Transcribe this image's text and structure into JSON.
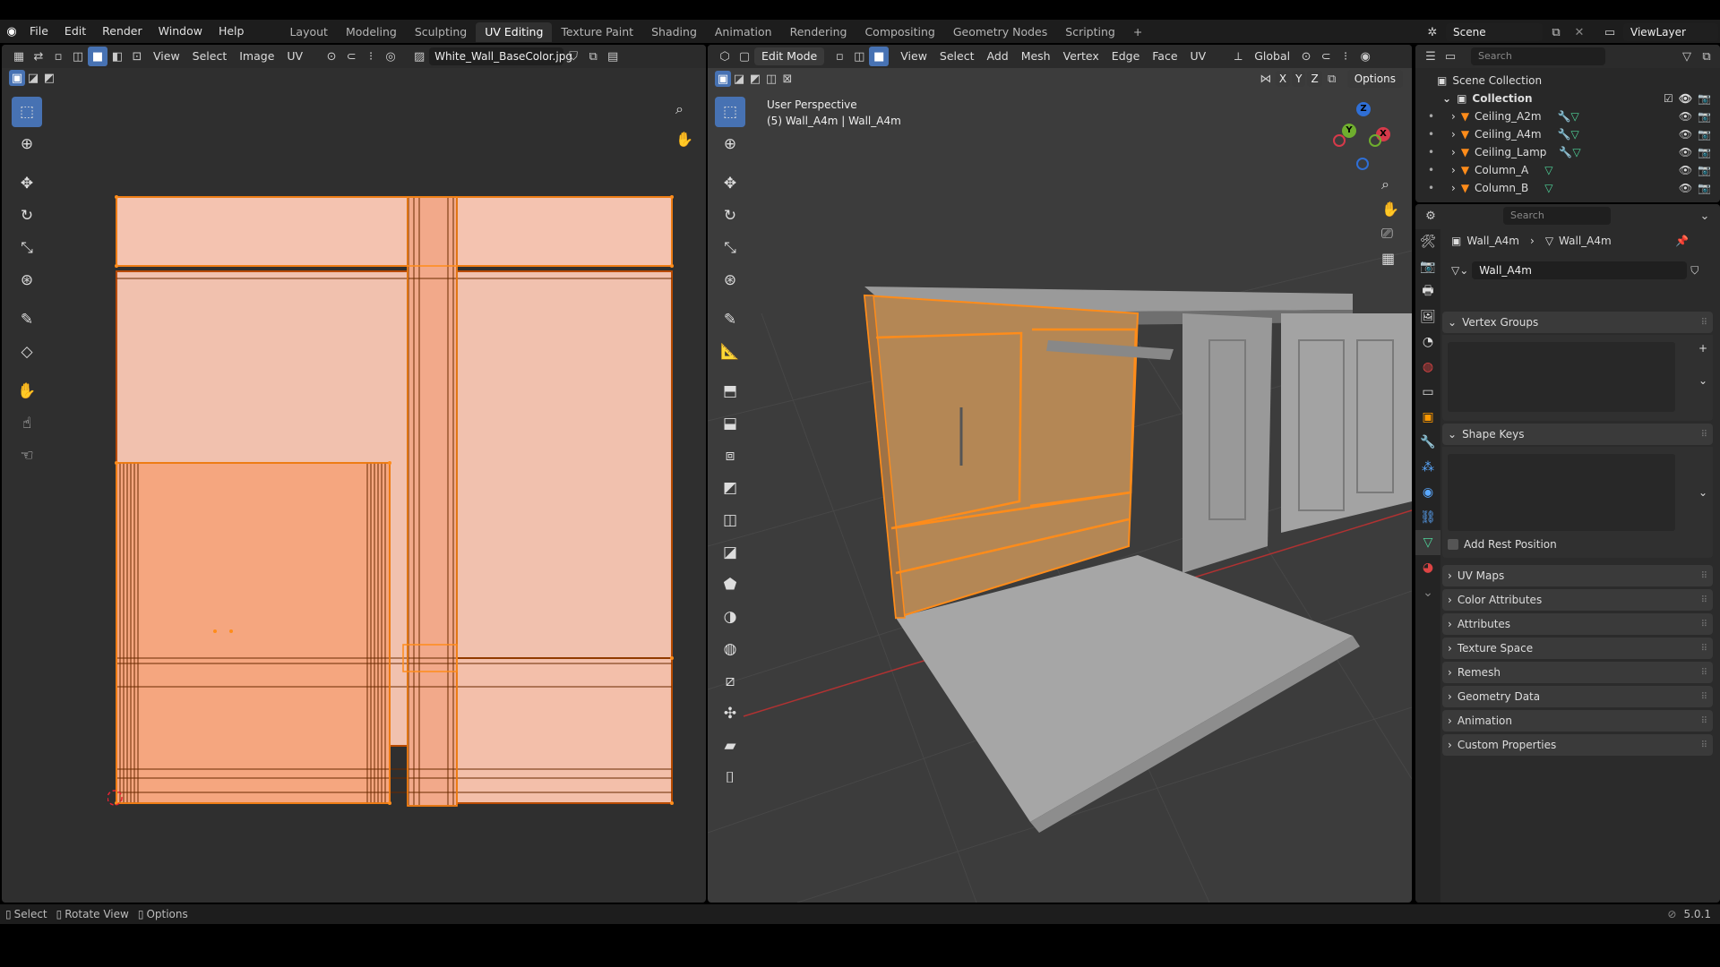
{
  "topbar": {
    "menus": [
      "File",
      "Edit",
      "Render",
      "Window",
      "Help"
    ],
    "workspaces": [
      "Layout",
      "Modeling",
      "Sculpting",
      "UV Editing",
      "Texture Paint",
      "Shading",
      "Animation",
      "Rendering",
      "Compositing",
      "Geometry Nodes",
      "Scripting"
    ],
    "active_workspace": "UV Editing",
    "add_tab": "+",
    "scene_label": "Scene",
    "viewlayer_label": "ViewLayer"
  },
  "uv_editor": {
    "menus": [
      "View",
      "Select",
      "Image",
      "UV"
    ],
    "image_name": "White_Wall_BaseColor.jpg",
    "colors": {
      "uv_fill": "#f4c3b0",
      "uv_selected": "#f5a67f",
      "uv_edge": "#ff8c1a",
      "bg": "#2f2f2f"
    }
  },
  "viewport": {
    "mode": "Edit Mode",
    "menus": [
      "View",
      "Select",
      "Add",
      "Mesh",
      "Vertex",
      "Edge",
      "Face",
      "UV"
    ],
    "transform_orientation": "Global",
    "axes": [
      "X",
      "Y",
      "Z"
    ],
    "options_label": "Options",
    "overlay_title": "User Perspective",
    "overlay_object": "(5) Wall_A4m | Wall_A4m",
    "gizmo": {
      "x": "X",
      "y": "Y",
      "z": "Z"
    }
  },
  "outliner": {
    "search_placeholder": "Search",
    "root": "Scene Collection",
    "collection": "Collection",
    "items": [
      {
        "name": "Ceiling_A2m"
      },
      {
        "name": "Ceiling_A4m"
      },
      {
        "name": "Ceiling_Lamp"
      },
      {
        "name": "Column_A"
      },
      {
        "name": "Column_B"
      }
    ]
  },
  "properties": {
    "search_placeholder": "Search",
    "breadcrumb": [
      "Wall_A4m",
      "Wall_A4m"
    ],
    "mesh_name": "Wall_A4m",
    "vertex_groups": "Vertex Groups",
    "shape_keys": "Shape Keys",
    "add_rest_position": "Add Rest Position",
    "sections": [
      "UV Maps",
      "Color Attributes",
      "Attributes",
      "Texture Space",
      "Remesh",
      "Geometry Data",
      "Animation",
      "Custom Properties"
    ]
  },
  "statusbar": {
    "select": "Select",
    "rotate": "Rotate View",
    "options": "Options",
    "version": "5.0.1"
  }
}
